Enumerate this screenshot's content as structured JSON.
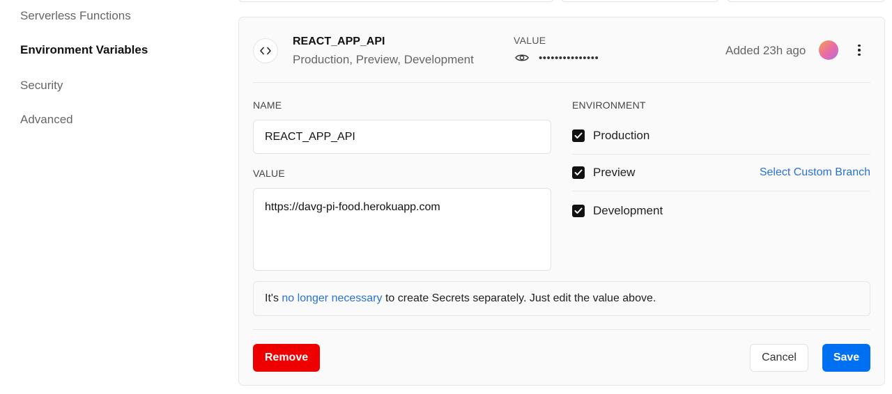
{
  "sidebar": {
    "items": [
      {
        "label": "Serverless Functions"
      },
      {
        "label": "Environment Variables"
      },
      {
        "label": "Security"
      },
      {
        "label": "Advanced"
      }
    ],
    "active_index": 1
  },
  "variable": {
    "name": "REACT_APP_API",
    "environments_summary": "Production, Preview, Development",
    "value_label": "VALUE",
    "masked_value": "•••••••••••••••",
    "added": "Added 23h ago",
    "code_icon": "code-brackets-icon",
    "eye_icon": "eye-icon",
    "more_icon": "more-vertical-icon"
  },
  "form": {
    "name_label": "NAME",
    "name_value": "REACT_APP_API",
    "value_label": "VALUE",
    "value_value": "https://davg-pi-food.herokuapp.com",
    "environment_label": "ENVIRONMENT",
    "environments": [
      {
        "label": "Production",
        "checked": true
      },
      {
        "label": "Preview",
        "checked": true,
        "link": "Select Custom Branch"
      },
      {
        "label": "Development",
        "checked": true
      }
    ]
  },
  "notice": {
    "prefix": "It's",
    "link": "no longer necessary",
    "suffix": "to create Secrets separately. Just edit the value above."
  },
  "actions": {
    "remove": "Remove",
    "cancel": "Cancel",
    "save": "Save"
  },
  "colors": {
    "accent": "#0070f3",
    "danger": "#ee0000",
    "link": "#2771d8"
  }
}
